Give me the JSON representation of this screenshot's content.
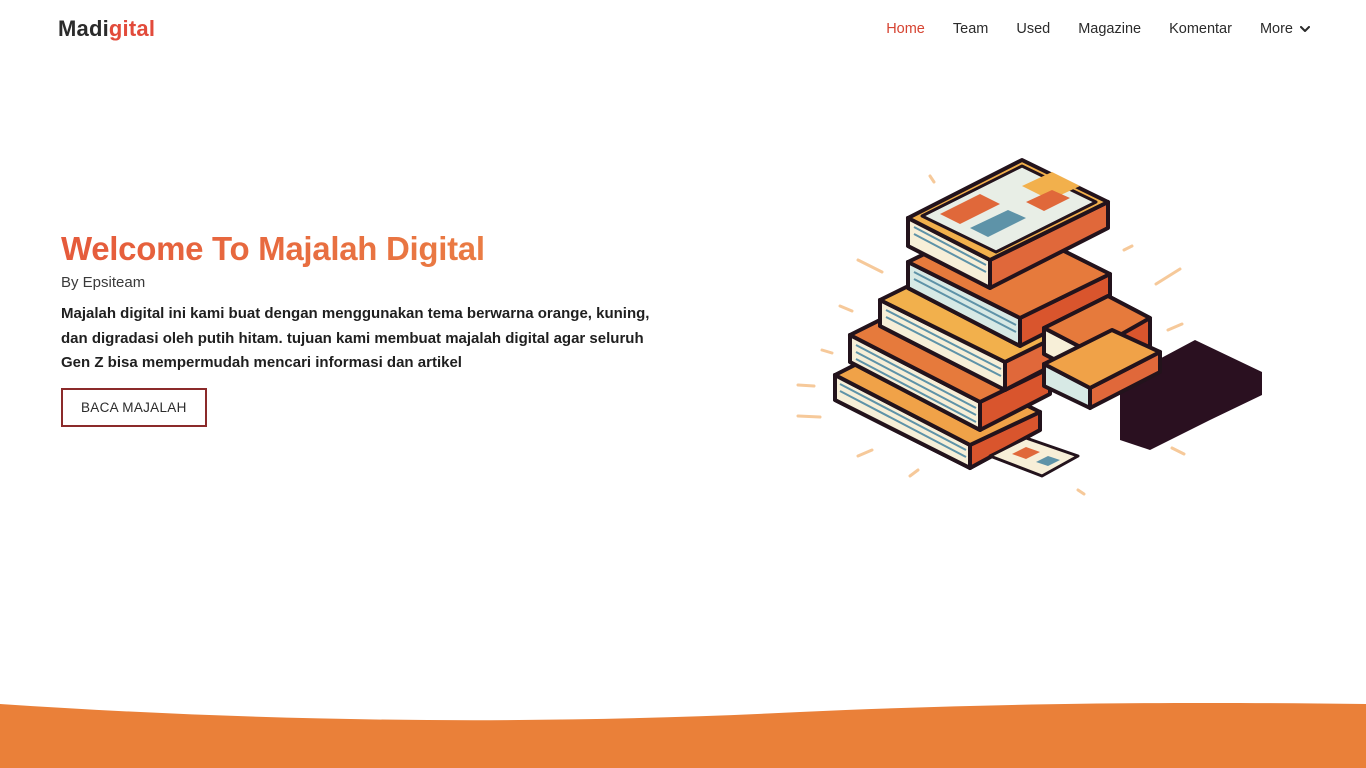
{
  "brand": {
    "part1": "Madi",
    "part2": "gital"
  },
  "nav": {
    "items": [
      {
        "label": "Home"
      },
      {
        "label": "Team"
      },
      {
        "label": "Used"
      },
      {
        "label": "Magazine"
      },
      {
        "label": "Komentar"
      },
      {
        "label": "More"
      }
    ]
  },
  "hero": {
    "title": "Welcome To Majalah Digital",
    "byline": "By Epsiteam",
    "description": "Majalah digital ini kami buat dengan menggunakan tema berwarna orange, kuning, dan digradasi oleh putih hitam. tujuan kami membuat majalah digital agar seluruh Gen Z bisa mempermudah mencari informasi dan artikel",
    "button_label": "BACA MAJALAH"
  },
  "colors": {
    "accent": "#e24b3b",
    "title_gradient_start": "#e55a3b",
    "title_gradient_end": "#ec8a47",
    "button_border": "#8b2a2a",
    "wave": "#ea8039"
  }
}
